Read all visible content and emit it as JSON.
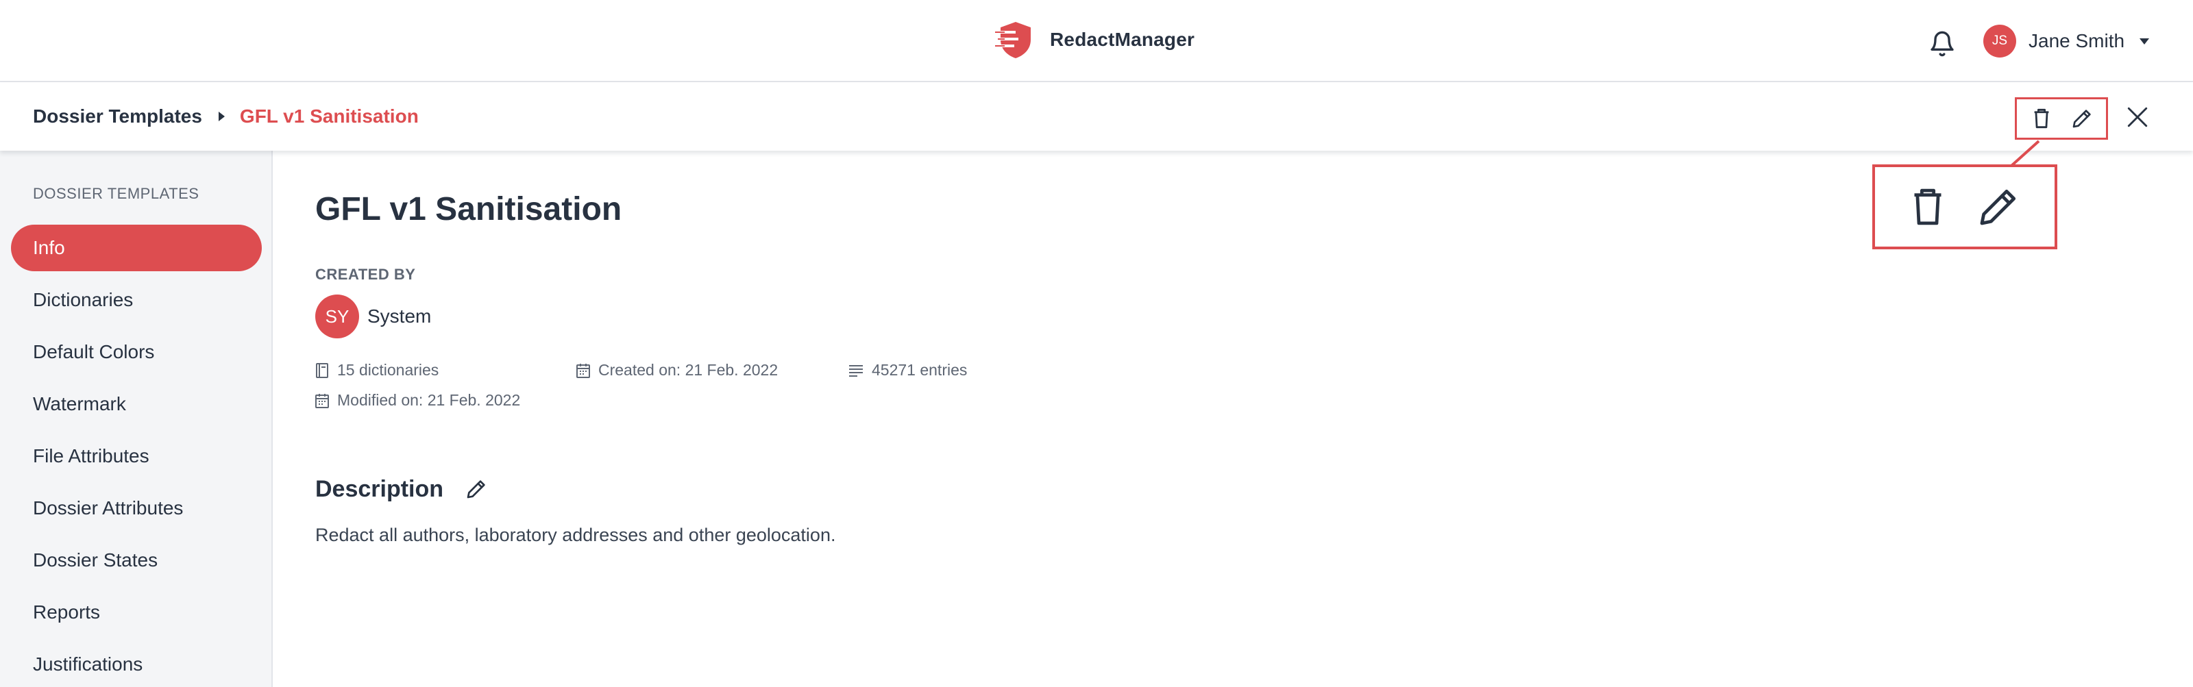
{
  "app": {
    "name": "RedactManager",
    "accent": "#dd4d50",
    "text_color": "#283241",
    "muted_color": "#5e6673"
  },
  "header": {
    "notifications_icon": "bell-icon",
    "user": {
      "initials": "JS",
      "name": "Jane Smith"
    }
  },
  "breadcrumb": {
    "root": "Dossier Templates",
    "current": "GFL v1 Sanitisation"
  },
  "toolbar": {
    "delete_icon": "trash-icon",
    "edit_icon": "pencil-icon",
    "close_icon": "close-icon"
  },
  "sidebar": {
    "title": "DOSSIER TEMPLATES",
    "items": [
      {
        "label": "Info",
        "active": true
      },
      {
        "label": "Dictionaries",
        "active": false
      },
      {
        "label": "Default Colors",
        "active": false
      },
      {
        "label": "Watermark",
        "active": false
      },
      {
        "label": "File Attributes",
        "active": false
      },
      {
        "label": "Dossier Attributes",
        "active": false
      },
      {
        "label": "Dossier States",
        "active": false
      },
      {
        "label": "Reports",
        "active": false
      },
      {
        "label": "Justifications",
        "active": false
      }
    ]
  },
  "main": {
    "title": "GFL v1 Sanitisation",
    "created_by_label": "CREATED BY",
    "creator": {
      "initials": "SY",
      "name": "System"
    },
    "stats": {
      "dictionaries": "15 dictionaries",
      "created_on": "Created on: 21 Feb. 2022",
      "entries": "45271 entries",
      "modified_on": "Modified on: 21 Feb. 2022"
    },
    "description": {
      "heading": "Description",
      "text": "Redact all authors, laboratory addresses and other geolocation."
    }
  }
}
